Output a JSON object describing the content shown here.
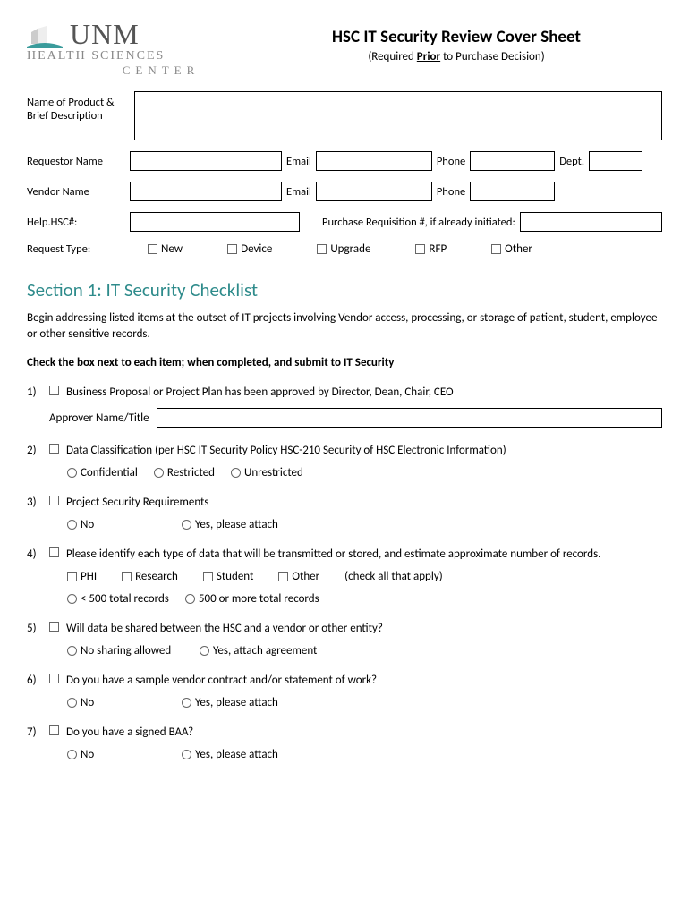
{
  "logo": {
    "text": "UNM",
    "sub": "HEALTH SCIENCES",
    "sub2": "CENTER"
  },
  "title": "HSC IT Security Review Cover Sheet",
  "subtitle_pre": "(Required ",
  "subtitle_underline": "Prior",
  "subtitle_post": " to Purchase Decision)",
  "labels": {
    "product_desc": "Name of Product & Brief Description",
    "requestor": "Requestor Name",
    "email": "Email",
    "phone": "Phone",
    "dept": "Dept.",
    "vendor": "Vendor Name",
    "help_hsc": "Help.HSC#:",
    "purchase_req": "Purchase Requisition #, if already initiated:",
    "request_type": "Request Type:"
  },
  "request_types": {
    "new": "New",
    "device": "Device",
    "upgrade": "Upgrade",
    "rfp": "RFP",
    "other": "Other"
  },
  "section1": {
    "title": "Section 1:  IT Security Checklist",
    "intro": "Begin addressing listed items at the outset of IT projects involving Vendor access, processing, or storage of patient, student, employee or other sensitive records.",
    "instruct": "Check the box next to each item; when completed, and submit to IT Security"
  },
  "items": {
    "1": {
      "num": "1)",
      "text": "Business Proposal or Project Plan has been approved by Director, Dean, Chair, CEO",
      "approver_label": "Approver Name/Title"
    },
    "2": {
      "num": "2)",
      "text": "Data Classification (per HSC IT Security Policy HSC-210 Security of HSC Electronic Information)",
      "opts": {
        "a": "Confidential",
        "b": "Restricted",
        "c": "Unrestricted"
      }
    },
    "3": {
      "num": "3)",
      "text": "Project Security Requirements",
      "opts": {
        "a": "No",
        "b": "Yes, please attach"
      }
    },
    "4": {
      "num": "4)",
      "text": "Please identify each type of data that will be transmitted or stored, and estimate approximate number of records.",
      "checks": {
        "a": "PHI",
        "b": "Research",
        "c": "Student",
        "d": "Other"
      },
      "check_note": "(check all that apply)",
      "radios": {
        "a": "< 500 total records",
        "b": "500 or more total records"
      }
    },
    "5": {
      "num": "5)",
      "text": "Will data be shared between the HSC and a vendor or other entity?",
      "opts": {
        "a": "No sharing allowed",
        "b": "Yes, attach agreement"
      }
    },
    "6": {
      "num": "6)",
      "text": "Do you have a sample vendor contract and/or statement of work?",
      "opts": {
        "a": "No",
        "b": "Yes, please attach"
      }
    },
    "7": {
      "num": "7)",
      "text": "Do you have a signed BAA?",
      "opts": {
        "a": "No",
        "b": "Yes, please attach"
      }
    }
  }
}
